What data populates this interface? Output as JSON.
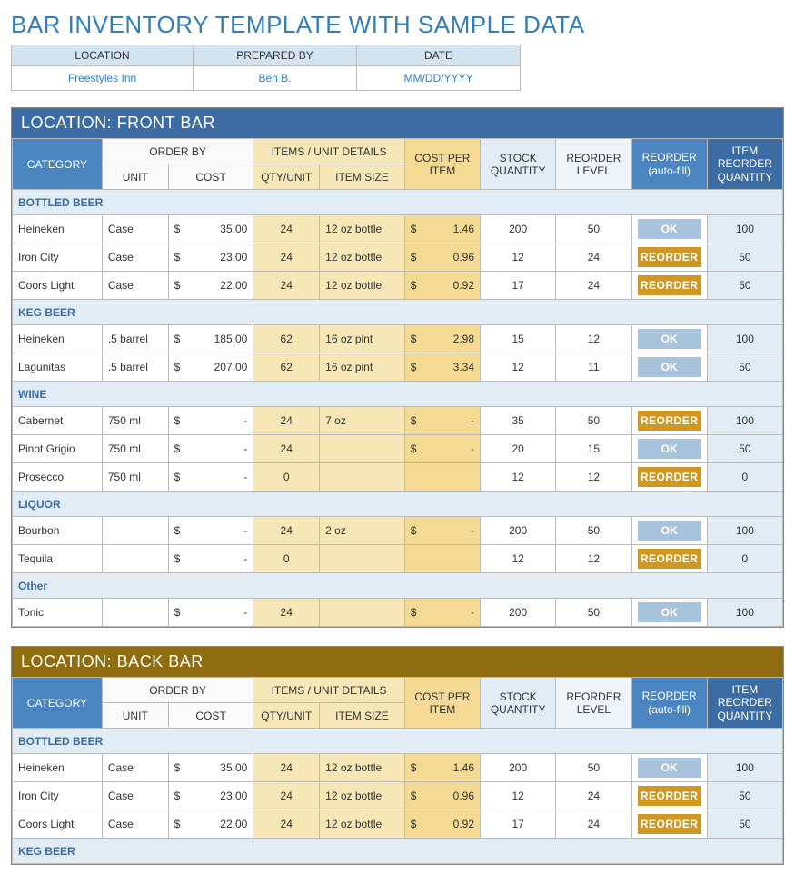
{
  "title": "BAR INVENTORY TEMPLATE WITH SAMPLE DATA",
  "info": {
    "location_hdr": "LOCATION",
    "prepared_hdr": "PREPARED BY",
    "date_hdr": "DATE",
    "location": "Freestyles Inn",
    "prepared": "Ben B.",
    "date": "MM/DD/YYYY"
  },
  "headers": {
    "category": "CATEGORY",
    "order_by": "ORDER BY",
    "unit": "UNIT",
    "cost": "COST",
    "items_details": "ITEMS / UNIT DETAILS",
    "qty_unit": "QTY/UNIT",
    "item_size": "ITEM SIZE",
    "cost_per_item": "COST PER ITEM",
    "stock_qty": "STOCK QUANTITY",
    "reorder_level": "REORDER LEVEL",
    "reorder_auto": "REORDER (auto-fill)",
    "item_reorder_qty": "ITEM REORDER QUANTITY"
  },
  "statuses": {
    "ok": "OK",
    "reorder": "REORDER"
  },
  "sections": [
    {
      "title": "LOCATION: FRONT BAR",
      "theme": "blue-bg",
      "groups": [
        {
          "name": "BOTTLED BEER",
          "rows": [
            {
              "name": "Heineken",
              "unit": "Case",
              "cost": "35.00",
              "qty": "24",
              "size": "12 oz bottle",
              "cpi": "1.46",
              "stock": "200",
              "level": "50",
              "status": "ok",
              "irq": "100"
            },
            {
              "name": "Iron City",
              "unit": "Case",
              "cost": "23.00",
              "qty": "24",
              "size": "12 oz bottle",
              "cpi": "0.96",
              "stock": "12",
              "level": "24",
              "status": "reorder",
              "irq": "50"
            },
            {
              "name": "Coors Light",
              "unit": "Case",
              "cost": "22.00",
              "qty": "24",
              "size": "12 oz bottle",
              "cpi": "0.92",
              "stock": "17",
              "level": "24",
              "status": "reorder",
              "irq": "50"
            }
          ]
        },
        {
          "name": "KEG BEER",
          "rows": [
            {
              "name": "Heineken",
              "unit": ".5 barrel",
              "cost": "185.00",
              "qty": "62",
              "size": "16 oz pint",
              "cpi": "2.98",
              "stock": "15",
              "level": "12",
              "status": "ok",
              "irq": "100"
            },
            {
              "name": "Lagunitas",
              "unit": ".5 barrel",
              "cost": "207.00",
              "qty": "62",
              "size": "16 oz pint",
              "cpi": "3.34",
              "stock": "12",
              "level": "11",
              "status": "ok",
              "irq": "50"
            }
          ]
        },
        {
          "name": "WINE",
          "rows": [
            {
              "name": "Cabernet",
              "unit": "750 ml",
              "cost": "-",
              "qty": "24",
              "size": "7 oz",
              "cpi": "-",
              "stock": "35",
              "level": "50",
              "status": "reorder",
              "irq": "100"
            },
            {
              "name": "Pinot Grigio",
              "unit": "750 ml",
              "cost": "-",
              "qty": "24",
              "size": "",
              "cpi": "-",
              "stock": "20",
              "level": "15",
              "status": "ok",
              "irq": "50"
            },
            {
              "name": "Prosecco",
              "unit": "750 ml",
              "cost": "-",
              "qty": "0",
              "size": "",
              "cpi": "",
              "stock": "12",
              "level": "12",
              "status": "reorder",
              "irq": "0"
            }
          ]
        },
        {
          "name": "LIQUOR",
          "rows": [
            {
              "name": "Bourbon",
              "unit": "",
              "cost": "-",
              "qty": "24",
              "size": "2 oz",
              "cpi": "-",
              "stock": "200",
              "level": "50",
              "status": "ok",
              "irq": "100"
            },
            {
              "name": "Tequila",
              "unit": "",
              "cost": "-",
              "qty": "0",
              "size": "",
              "cpi": "",
              "stock": "12",
              "level": "12",
              "status": "reorder",
              "irq": "0"
            }
          ]
        },
        {
          "name": "Other",
          "rows": [
            {
              "name": "Tonic",
              "unit": "",
              "cost": "-",
              "qty": "24",
              "size": "",
              "cpi": "-",
              "stock": "200",
              "level": "50",
              "status": "ok",
              "irq": "100"
            }
          ]
        }
      ]
    },
    {
      "title": "LOCATION: BACK BAR",
      "theme": "gold-bg",
      "groups": [
        {
          "name": "BOTTLED BEER",
          "rows": [
            {
              "name": "Heineken",
              "unit": "Case",
              "cost": "35.00",
              "qty": "24",
              "size": "12 oz bottle",
              "cpi": "1.46",
              "stock": "200",
              "level": "50",
              "status": "ok",
              "irq": "100"
            },
            {
              "name": "Iron City",
              "unit": "Case",
              "cost": "23.00",
              "qty": "24",
              "size": "12 oz bottle",
              "cpi": "0.96",
              "stock": "12",
              "level": "24",
              "status": "reorder",
              "irq": "50"
            },
            {
              "name": "Coors Light",
              "unit": "Case",
              "cost": "22.00",
              "qty": "24",
              "size": "12 oz bottle",
              "cpi": "0.92",
              "stock": "17",
              "level": "24",
              "status": "reorder",
              "irq": "50"
            }
          ]
        },
        {
          "name": "KEG BEER",
          "rows": []
        }
      ]
    }
  ],
  "chart_data": {
    "type": "table",
    "title": "Bar Inventory",
    "sections": [
      "FRONT BAR",
      "BACK BAR"
    ],
    "columns": [
      "CATEGORY",
      "UNIT",
      "COST",
      "QTY/UNIT",
      "ITEM SIZE",
      "COST PER ITEM",
      "STOCK QUANTITY",
      "REORDER LEVEL",
      "REORDER",
      "ITEM REORDER QUANTITY"
    ]
  }
}
